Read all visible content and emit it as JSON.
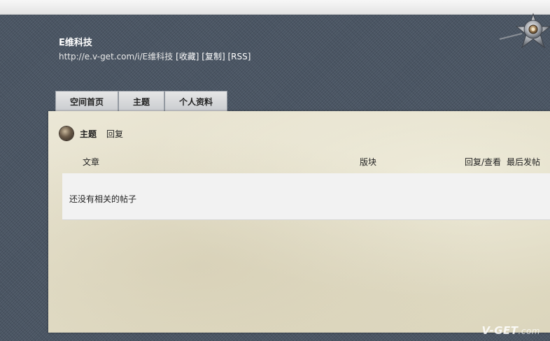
{
  "browser": {},
  "site": {
    "title": "E维科技",
    "url": "http://e.v-get.com/i/E维科技",
    "links": [
      "[收藏]",
      "[复制]",
      "[RSS]"
    ]
  },
  "nav": {
    "tabs": [
      "空间首页",
      "主题",
      "个人资料"
    ]
  },
  "panel": {
    "sub_tabs": [
      "主题",
      "回复"
    ],
    "columns": {
      "article": "文章",
      "forum": "版块",
      "replies_views": "回复/查看",
      "last_post": "最后发帖"
    },
    "empty_message": "还没有相关的帖子"
  },
  "watermark": {
    "brand": "V-GET",
    "suffix": ".com"
  }
}
